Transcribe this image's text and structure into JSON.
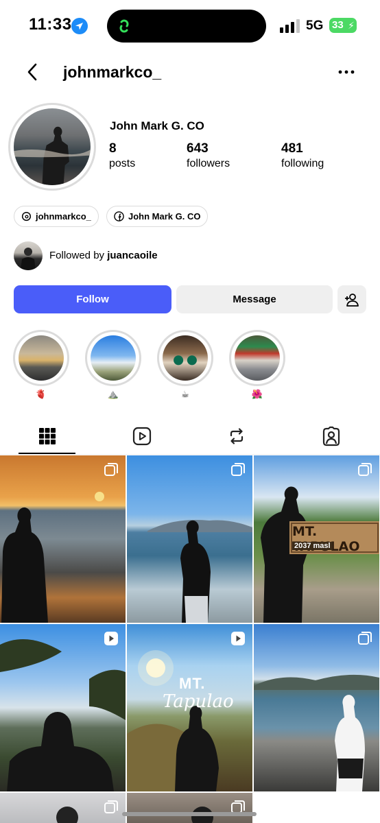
{
  "status_bar": {
    "time": "11:33",
    "network": "5G",
    "battery": "33"
  },
  "header": {
    "username": "johnmarkco_"
  },
  "profile": {
    "display_name": "John Mark G. CO",
    "stats": [
      {
        "value": "8",
        "label": "posts"
      },
      {
        "value": "643",
        "label": "followers"
      },
      {
        "value": "481",
        "label": "following"
      }
    ],
    "links": [
      {
        "icon": "threads-icon",
        "label": "johnmarkco_"
      },
      {
        "icon": "facebook-icon",
        "label": "John Mark G. CO"
      }
    ],
    "followed_by": {
      "prefix": "Followed by",
      "user": "juancaoile"
    }
  },
  "actions": {
    "follow": "Follow",
    "message": "Message"
  },
  "highlights": [
    {
      "label": "🫀"
    },
    {
      "label": "⛰️"
    },
    {
      "label": "☕"
    },
    {
      "label": "🌺"
    }
  ],
  "tabs": [
    "grid-icon",
    "reels-icon",
    "reposts-icon",
    "tagged-icon"
  ],
  "posts": [
    {
      "type": "carousel"
    },
    {
      "type": "carousel"
    },
    {
      "type": "carousel",
      "overlay_text": "MT. TAPULAO",
      "overlay_sub": "2037 masl"
    },
    {
      "type": "reel"
    },
    {
      "type": "reel",
      "overlay_text": "MT.",
      "overlay_sub": "Tapulao"
    },
    {
      "type": "carousel"
    }
  ],
  "colors": {
    "accent": "#4a5df9",
    "battery": "#4cd964",
    "divider": "#dbdbdb"
  }
}
